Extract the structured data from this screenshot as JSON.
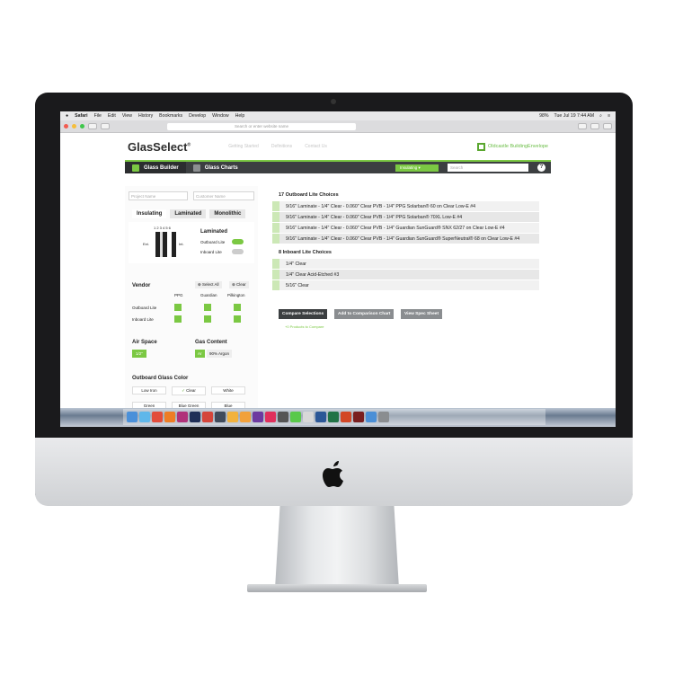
{
  "menubar": {
    "app": "Safari",
    "items": [
      "File",
      "Edit",
      "View",
      "History",
      "Bookmarks",
      "Develop",
      "Window",
      "Help"
    ],
    "battery": "98%",
    "clock": "Tue Jul 19  7:44 AM"
  },
  "browser": {
    "url_placeholder": "Search or enter website name"
  },
  "site": {
    "logo": "GlasSelect",
    "logo_mark": "®",
    "nav": [
      "Getting Started",
      "Definitions",
      "Contact Us"
    ],
    "brand": "Oldcastle BuildingEnvelope"
  },
  "greenbar": {
    "tab1": "Glass Builder",
    "tab2": "Glass Charts",
    "dropdown": "Insulating",
    "search_placeholder": "Search",
    "help": "?"
  },
  "left": {
    "project_name": "Project Name",
    "customer_name": "Customer Name",
    "tabs": [
      "Insulating",
      "Laminated",
      "Monolithic"
    ],
    "diagram_numbers": "1 2 3 4 5 6",
    "ext": "Ext.",
    "int": "Int.",
    "laminated_title": "Laminated",
    "outboard_lite": "Outboard Lite",
    "inboard_lite": "Inboard Lite",
    "vendor_title": "Vendor",
    "select_all": "Select All",
    "clear": "Clear",
    "vendors": [
      "PPG",
      "Guardian",
      "Pilkington"
    ],
    "vendor_rows": [
      "Outboard Lite",
      "Inboard Lite"
    ],
    "air_space": "Air Space",
    "air_value": "1/2\"",
    "gas_content": "Gas Content",
    "gas_value": "Ar",
    "gas_label": "90% Argon",
    "outboard_color": "Outboard Glass Color",
    "colors": [
      "Low Iron",
      "Clear",
      "White",
      "Green",
      "Blue Green",
      "Blue"
    ]
  },
  "right": {
    "outboard_count": "17",
    "outboard_title": "Outboard Lite Choices",
    "outboard_rows": [
      "9/16\" Laminate - 1/4\" Clear - 0.060\" Clear PVB - 1/4\" PPG Solarban® 60 on Clear Low-E #4",
      "9/16\" Laminate - 1/4\" Clear - 0.060\" Clear PVB - 1/4\" PPG Solarban® 70XL Low-E #4",
      "9/16\" Laminate - 1/4\" Clear - 0.060\" Clear PVB - 1/4\" Guardian SunGuard® SNX 62/27 on Clear Low-E #4",
      "9/16\" Laminate - 1/4\" Clear - 0.060\" Clear PVB - 1/4\" Guardian SunGuard® SuperNeutral® 68 on Clear Low-E #4"
    ],
    "inboard_count": "8",
    "inboard_title": "Inboard Lite Choices",
    "inboard_rows": [
      "1/4\" Clear",
      "1/4\" Clear Acid-Etched #3",
      "5/16\" Clear"
    ],
    "btn_compare": "Compare Selections",
    "btn_add": "Add to Comparison Chart",
    "btn_spec": "View Spec Sheet",
    "note": "+0 Products to Compare"
  },
  "colors": {
    "accent": "#7bc843",
    "dark": "#3c3f41"
  }
}
